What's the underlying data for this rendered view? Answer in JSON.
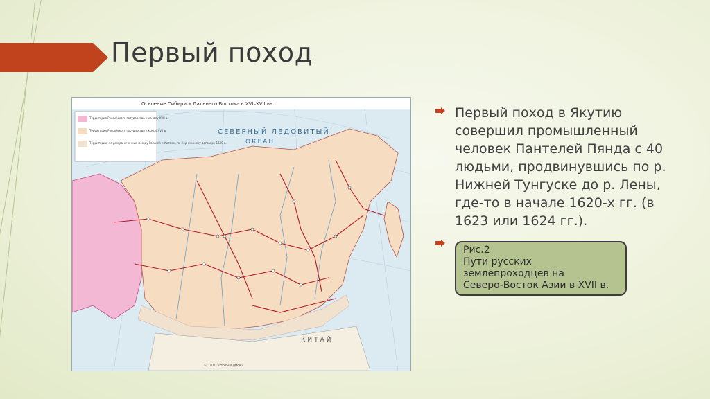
{
  "slide": {
    "title": "Первый поход",
    "bullets": [
      {
        "text": "Первый поход в Якутию совершил промышленный человек Пантелей Пянда с 40 людьми, продвинувшись по р. Нижней Тунгуске до р. Лены, где-то в начале 1620-х гг. (в 1623 или 1624 гг.)."
      }
    ],
    "caption": {
      "line1": "Рис.2",
      "line2": "Пути русских",
      "line3": "землепроходцев на",
      "line4": "Северо-Восток Азии в XVII в."
    },
    "accent_color": "#c0431e"
  },
  "map": {
    "header_title": "Освоение Сибири и Дальнего Востока в XVI–XVII вв.",
    "ocean_label_1": "СЕВЕРНЫЙ ЛЕДОВИТЫЙ",
    "ocean_label_2": "ОКЕАН",
    "country_label": "КИТАЙ",
    "publisher": "© ООО «Новый диск»",
    "legend": [
      {
        "text": "Территория Российского государства к началу XVII в.",
        "color": "#f3b8d4"
      },
      {
        "text": "Территория Российского государства к концу XVII в.",
        "color": "#f6dcc0"
      },
      {
        "text": "Территории, не разграниченные между Россией и Китаем, по Нерчинскому договору 1689 г.",
        "color": "#f1e2cf"
      }
    ]
  }
}
